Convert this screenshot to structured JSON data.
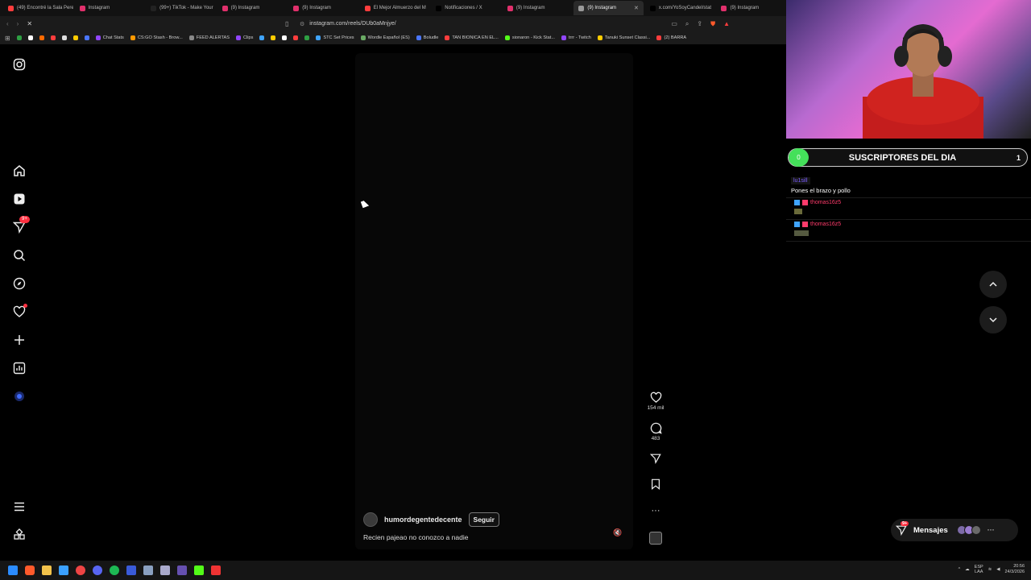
{
  "browser": {
    "tabs": [
      {
        "label": "(49) Encontré la Sala Pere",
        "fav": "#ff3d3d"
      },
      {
        "label": "Instagram",
        "fav": "#e1306c"
      },
      {
        "label": "(99+) TikTok - Make Your",
        "fav": "#222222"
      },
      {
        "label": "(9) Instagram",
        "fav": "#e1306c"
      },
      {
        "label": "(9) Instagram",
        "fav": "#e1306c"
      },
      {
        "label": "El Mejor Almuerzo del M",
        "fav": "#ff3d3d"
      },
      {
        "label": "Notificaciones / X",
        "fav": "#000000"
      },
      {
        "label": "(9) Instagram",
        "fav": "#e1306c"
      },
      {
        "label": "(9) Instagram",
        "fav": "#999999",
        "active": true
      },
      {
        "label": "x.com/YoSoyCandel/stat",
        "fav": "#000000"
      },
      {
        "label": "(9) Instagram",
        "fav": "#e1306c"
      }
    ],
    "url": "instagram.com/reels/DUb0aMnjye/",
    "bookmarks": [
      {
        "label": "",
        "c": "#2ea043"
      },
      {
        "label": "",
        "c": "#ffffff"
      },
      {
        "label": "",
        "c": "#ff6a00"
      },
      {
        "label": "",
        "c": "#ff3d3d"
      },
      {
        "label": "",
        "c": "#dddddd"
      },
      {
        "label": "",
        "c": "#ffcc00"
      },
      {
        "label": "",
        "c": "#4a76ff"
      },
      {
        "label": "Chat Stats",
        "c": "#9146ff"
      },
      {
        "label": "CS:GO Stash - Brow...",
        "c": "#ff9900"
      },
      {
        "label": "FEED ALERTAS",
        "c": "#888888"
      },
      {
        "label": "Clips",
        "c": "#9146ff"
      },
      {
        "label": "",
        "c": "#3fa4ff"
      },
      {
        "label": "",
        "c": "#ffcc00"
      },
      {
        "label": "",
        "c": "#ffffff"
      },
      {
        "label": "",
        "c": "#ff3d3d"
      },
      {
        "label": "",
        "c": "#2ea043"
      },
      {
        "label": "STC Set Prices",
        "c": "#3fa4ff"
      },
      {
        "label": "Wordle Español (ES)",
        "c": "#6aaa64"
      },
      {
        "label": "Boludle",
        "c": "#4a76ff"
      },
      {
        "label": "TAN BIONICA EN EL...",
        "c": "#ff3d3d"
      },
      {
        "label": "sionaron - Kick Stat...",
        "c": "#53fc18"
      },
      {
        "label": "trrr - Twitch",
        "c": "#9146ff"
      },
      {
        "label": "Tanuki Sunset Classi...",
        "c": "#ffcc00"
      },
      {
        "label": "(2) BARRA",
        "c": "#ff3d3d"
      }
    ]
  },
  "reel": {
    "owner": "humordegentedecente",
    "follow_label": "Seguir",
    "caption": "Recien pajeao no conozco a nadie",
    "likes": "154 mil",
    "comments": "483"
  },
  "overlay": {
    "subs_count": "0",
    "subs_title": "SUSCRIPTORES DEL DIA",
    "subs_number": "1",
    "chat": [
      {
        "user": "lu1sill",
        "text": "Pones el brazo y pollo"
      },
      {
        "user": "thomas16z5",
        "text": ""
      },
      {
        "user": "thomas16z5",
        "text": ""
      }
    ]
  },
  "messages_label": "Mensajes",
  "messages_badge": "9+",
  "notif_badge": "9+",
  "tray": {
    "lang1": "ESP",
    "lang2": "LAA",
    "time": "20:56",
    "date": "24/3/2026"
  }
}
